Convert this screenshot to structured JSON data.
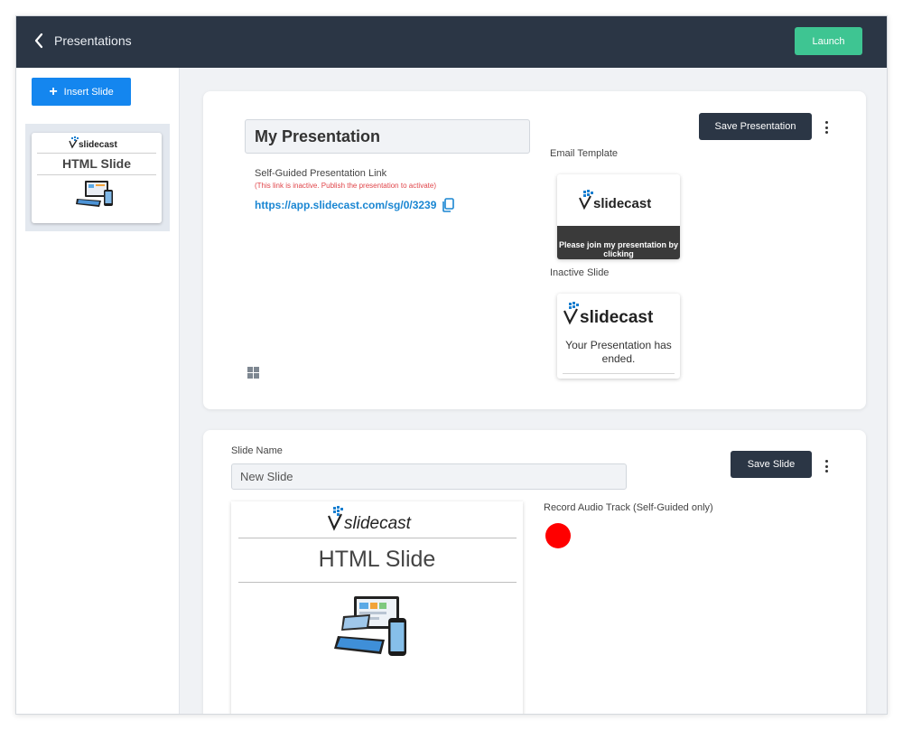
{
  "header": {
    "back_label": "Presentations",
    "launch_label": "Launch"
  },
  "sidebar": {
    "insert_label": "Insert Slide",
    "thumbnail": {
      "logo_text": "slidecast",
      "title": "HTML Slide"
    }
  },
  "presentation": {
    "title": "My Presentation",
    "self_guided_label": "Self-Guided Presentation Link",
    "inactive_note": "(This link is inactive. Publish the presentation to activate)",
    "link": "https://app.slidecast.com/sg/0/3239",
    "save_label": "Save Presentation",
    "email_template_label": "Email Template",
    "email_preview": {
      "logo_text": "slidecast",
      "message": "Please join my presentation by clicking"
    },
    "inactive_slide_label": "Inactive Slide",
    "inactive_preview": {
      "logo_text": "slidecast",
      "message": "Your Presentation has ended."
    }
  },
  "slide": {
    "name_label": "Slide Name",
    "name_value": "New Slide",
    "save_label": "Save Slide",
    "preview": {
      "logo_text": "slidecast",
      "title": "HTML Slide"
    },
    "record_label": "Record Audio Track (Self-Guided only)"
  },
  "colors": {
    "topbar": "#2b3645",
    "launch": "#3ec592",
    "insert": "#1486ef",
    "link": "#1a86d2",
    "warning": "#e0454a",
    "record": "#ff0000"
  }
}
